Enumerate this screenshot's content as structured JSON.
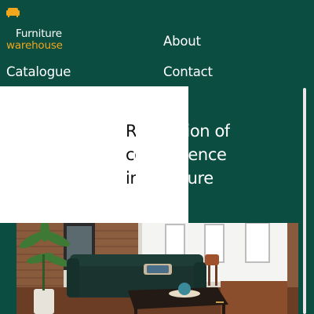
{
  "brand": {
    "icon": "sofa-icon",
    "line1": "Furniture",
    "line2": "warehouse",
    "accent_color": "#f1a61c"
  },
  "nav": {
    "about": "About",
    "catalogue": "Catalogue",
    "contact": "Contact"
  },
  "hero": {
    "title": "Revolution of\nconvenience\nin furniture",
    "background_color": "#0b4d40"
  },
  "image": {
    "alt": "living room with green sofa and coffee table"
  }
}
